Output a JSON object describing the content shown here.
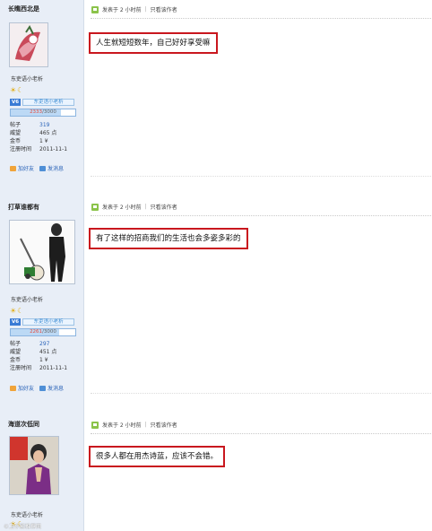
{
  "posts": [
    {
      "username": "长瞧西北是",
      "nickname": "东吏语小老析",
      "level_badge": "V6",
      "level_title": "东吏语小老析",
      "points_current": "2333",
      "points_max": "3000",
      "points_fraction": 0.78,
      "stats": [
        {
          "k": "帖子",
          "v": "319"
        },
        {
          "k": "威望",
          "v": "465 点"
        },
        {
          "k": "金币",
          "v": "1 ¥"
        },
        {
          "k": "注册时间",
          "v": "2011-11-1"
        }
      ],
      "add_friend": "加好友",
      "send_msg": "发消息",
      "posted": "发表于 2 小时前",
      "only_author": "只看该作者",
      "message": "人生就短短数年，自己好好享受嘛"
    },
    {
      "username": "打草谁都有",
      "nickname": "东吏语小老析",
      "level_badge": "V6",
      "level_title": "东吏语小老析",
      "points_current": "2261",
      "points_max": "3000",
      "points_fraction": 0.75,
      "stats": [
        {
          "k": "帖子",
          "v": "297"
        },
        {
          "k": "威望",
          "v": "451 点"
        },
        {
          "k": "金币",
          "v": "1 ¥"
        },
        {
          "k": "注册时间",
          "v": "2011-11-1"
        }
      ],
      "add_friend": "加好友",
      "send_msg": "发消息",
      "posted": "发表于 2 小时前",
      "only_author": "只看该作者",
      "message": "有了这样的招商我们的生活也会多姿多彩的"
    },
    {
      "username": "海道次低同",
      "nickname": "东吏语小老析",
      "posted": "发表于 2 小时前",
      "only_author": "只看该作者",
      "message": "很多人都在用杰诗蓝，应该不会错。"
    }
  ],
  "watermark": "©卫小影推荐网",
  "colors": {
    "highlight_border": "#c9171e",
    "sidebar_bg": "#e8eef7",
    "link": "#2a63b8"
  }
}
